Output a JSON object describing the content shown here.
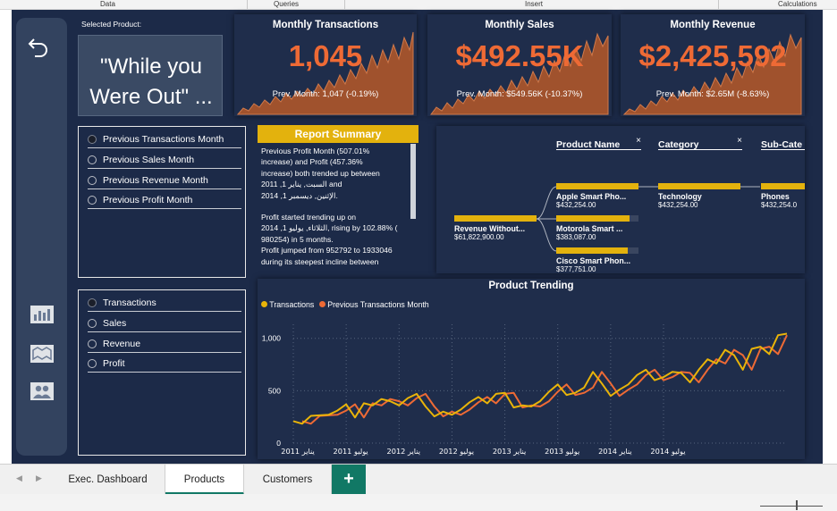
{
  "ribbon": {
    "groups": [
      "Data",
      "Queries",
      "Insert",
      "Calculations"
    ]
  },
  "report": {
    "selected_product_label": "Selected Product:",
    "selected_product": "\"While you Were Out\" ...",
    "kpis": [
      {
        "title": "Monthly Transactions",
        "value": "1,045",
        "sub": "Prev. Month: 1,047 (-0.19%)"
      },
      {
        "title": "Monthly Sales",
        "value": "$492.55K",
        "sub": "Prev. Month: $549.56K (-10.37%)"
      },
      {
        "title": "Monthly Revenue",
        "value": "$2,425,592",
        "sub": "Prev. Month: $2.65M (-8.63%)"
      }
    ],
    "compare_options": [
      "Previous Transactions Month",
      "Previous Sales Month",
      "Previous Revenue Month",
      "Previous Profit Month"
    ],
    "compare_selected": 0,
    "metric_options": [
      "Transactions",
      "Sales",
      "Revenue",
      "Profit"
    ],
    "metric_selected": 0,
    "summary": {
      "title": "Report Summary",
      "lines_1": [
        "Previous Profit Month (507.01%",
        "increase) and Profit (457.36%",
        "increase) both trended up between",
        "2011 ,السبت, يناير 1 and",
        "2014 ,الإثنين, ديسمبر 1."
      ],
      "lines_2": [
        "Profit started trending up on",
        "2014 ,الثلاثاء, يوليو 1, rising by 102.88% (",
        "980254) in 5 months.",
        "Profit jumped from 952792 to 1933046",
        "during its steepest incline between"
      ]
    },
    "decomp": {
      "headers": [
        "Product Name",
        "Category",
        "Sub-Cate"
      ],
      "root": {
        "label": "Revenue Without...",
        "value": "$61,822,900.00"
      },
      "products": [
        {
          "label": "Apple Smart Pho...",
          "value": "$432,254.00"
        },
        {
          "label": "Motorola Smart ...",
          "value": "$383,087.00"
        },
        {
          "label": "Cisco Smart Phon...",
          "value": "$377,751.00"
        }
      ],
      "category": {
        "label": "Technology",
        "value": "$432,254.00"
      },
      "subcategory": {
        "label": "Phones",
        "value": "$432,254.0"
      }
    },
    "sidebar_icons": [
      "back-arrow-icon",
      "bar-chart-icon",
      "map-icon",
      "people-icon"
    ]
  },
  "chart_data": {
    "type": "line",
    "title": "Product Trending",
    "xlabel": "",
    "ylabel": "",
    "ylim": [
      0,
      1100
    ],
    "yticks": [
      "0",
      "500",
      "1,000"
    ],
    "xticks": [
      "2011 يناير",
      "2011 يوليو",
      "2012 يناير",
      "2012 يوليو",
      "2013 يناير",
      "2013 يوليو",
      "2014 يناير",
      "2014 يوليو"
    ],
    "colors": {
      "Transactions": "#e9b409",
      "Previous Transactions Month": "#ee6a35"
    },
    "series": [
      {
        "name": "Transactions",
        "values": [
          210,
          185,
          260,
          265,
          270,
          310,
          370,
          245,
          380,
          360,
          420,
          400,
          360,
          430,
          470,
          350,
          255,
          300,
          270,
          320,
          390,
          440,
          380,
          470,
          480,
          340,
          360,
          350,
          400,
          490,
          560,
          460,
          480,
          530,
          680,
          570,
          450,
          510,
          560,
          650,
          700,
          600,
          630,
          680,
          670,
          580,
          700,
          800,
          760,
          890,
          840,
          700,
          900,
          920,
          850,
          1030,
          1045
        ]
      },
      {
        "name": "Previous Transactions Month",
        "values": [
          null,
          210,
          185,
          260,
          265,
          270,
          310,
          370,
          245,
          380,
          360,
          420,
          400,
          360,
          430,
          470,
          350,
          255,
          300,
          270,
          320,
          390,
          440,
          380,
          470,
          480,
          340,
          360,
          350,
          400,
          490,
          560,
          460,
          480,
          530,
          680,
          570,
          450,
          510,
          560,
          650,
          700,
          600,
          630,
          680,
          670,
          580,
          700,
          800,
          760,
          890,
          840,
          700,
          900,
          920,
          850,
          1030
        ]
      }
    ]
  },
  "tabs": [
    "Exec. Dashboard",
    "Products",
    "Customers"
  ],
  "tabs_active": 1,
  "add_tab_label": "+"
}
